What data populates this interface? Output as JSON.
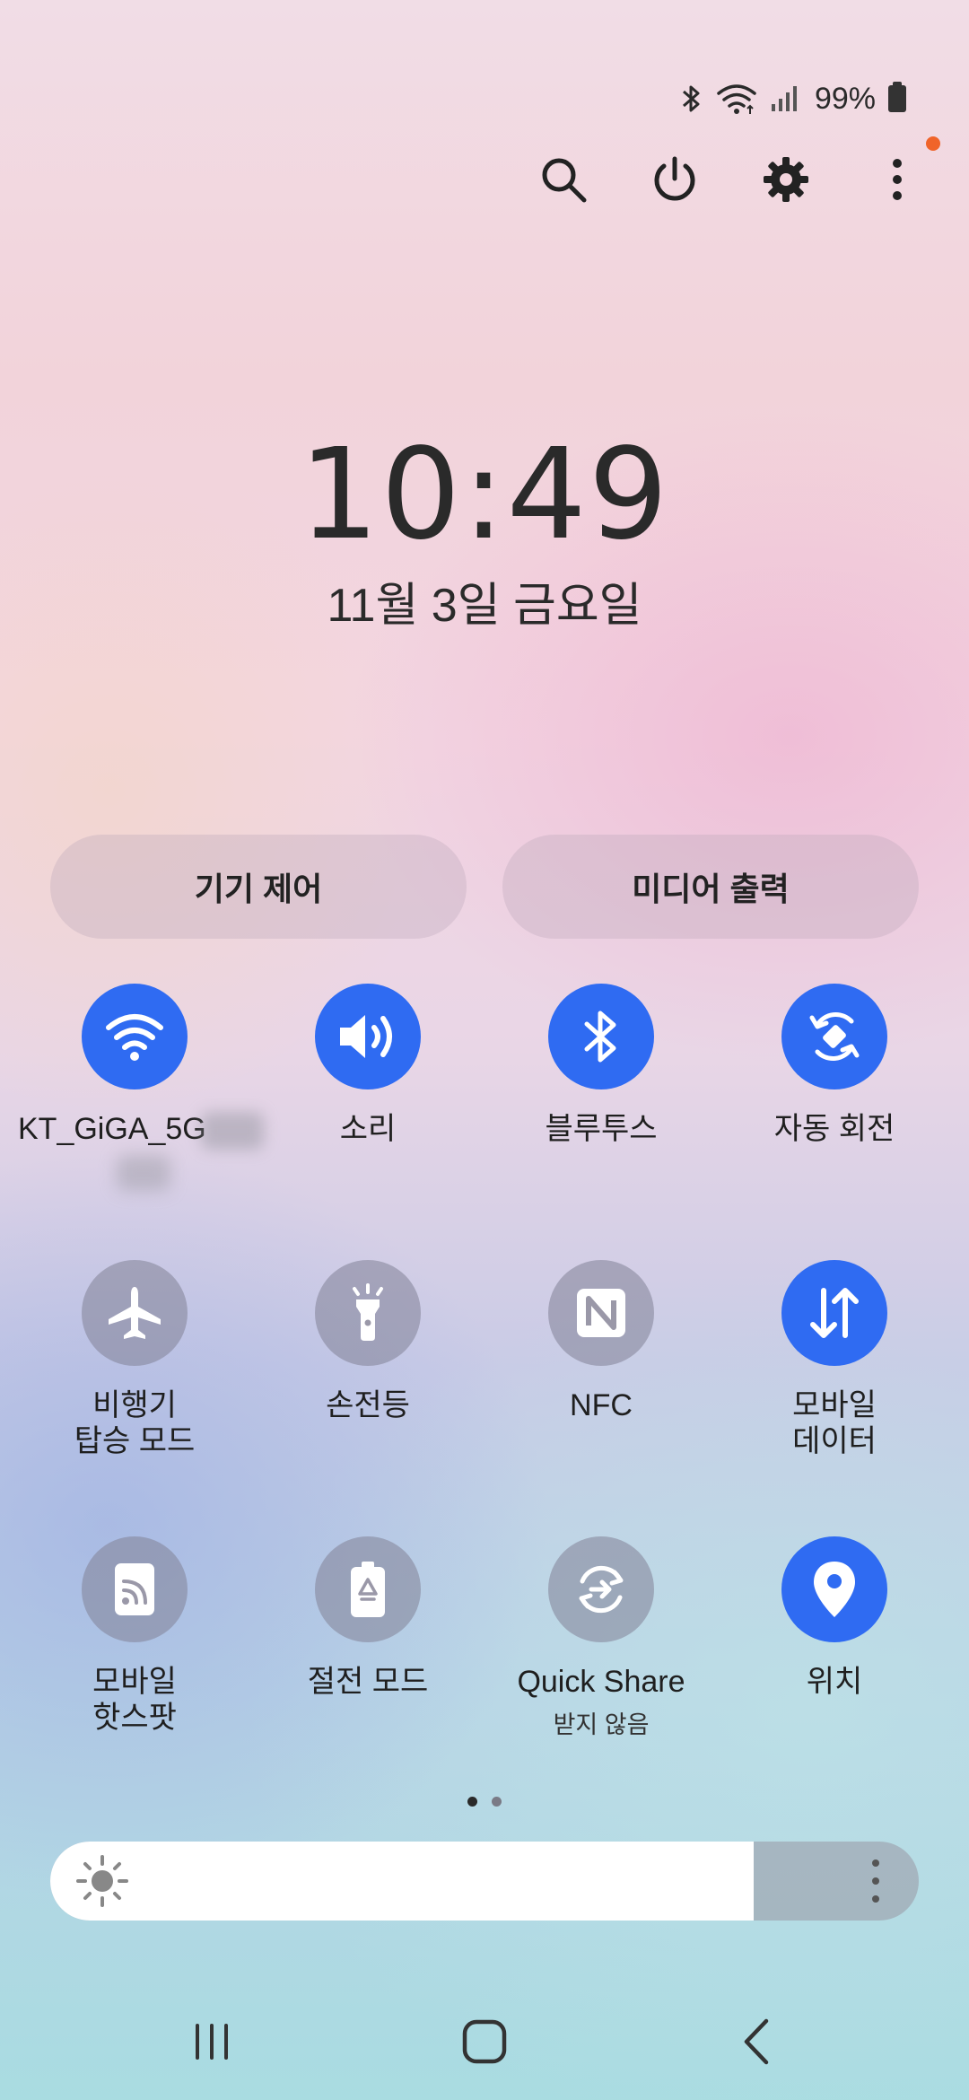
{
  "status": {
    "battery": "99%"
  },
  "clock": {
    "time": "10:49",
    "date": "11월 3일 금요일"
  },
  "buttons": {
    "device_control": "기기 제어",
    "media_output": "미디어 출력"
  },
  "tiles": [
    {
      "label": "KT_GiGA_5G",
      "state": "on",
      "icon": "wifi-icon"
    },
    {
      "label": "소리",
      "state": "on",
      "icon": "sound-icon"
    },
    {
      "label": "블루투스",
      "state": "on",
      "icon": "bluetooth-icon"
    },
    {
      "label": "자동 회전",
      "state": "on",
      "icon": "auto-rotate-icon"
    },
    {
      "label": "비행기",
      "label2": "탑승 모드",
      "state": "off",
      "icon": "airplane-icon"
    },
    {
      "label": "손전등",
      "state": "off",
      "icon": "flashlight-icon"
    },
    {
      "label": "NFC",
      "state": "off",
      "icon": "nfc-icon"
    },
    {
      "label": "모바일",
      "label2": "데이터",
      "state": "on",
      "icon": "mobile-data-icon"
    },
    {
      "label": "모바일",
      "label2": "핫스팟",
      "state": "off",
      "icon": "hotspot-icon"
    },
    {
      "label": "절전 모드",
      "state": "off",
      "icon": "power-saving-icon"
    },
    {
      "label": "Quick Share",
      "sub": "받지 않음",
      "state": "off",
      "icon": "quick-share-icon"
    },
    {
      "label": "위치",
      "state": "on",
      "icon": "location-icon"
    }
  ],
  "pager": {
    "pages": 2,
    "current": 1
  },
  "brightness": {
    "level": 0.81
  },
  "colors": {
    "accent": "#2f6bf2",
    "tile_off": "#9a98a8",
    "notification_dot": "#f0642a"
  }
}
